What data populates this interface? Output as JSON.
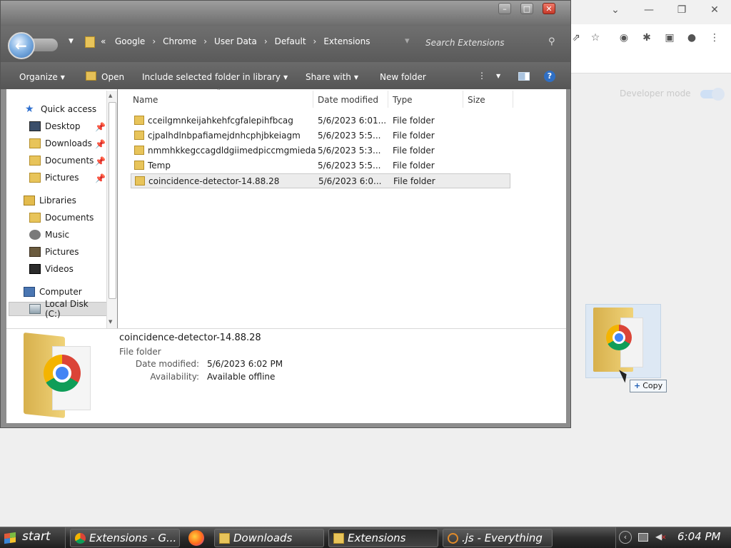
{
  "explorer": {
    "breadcrumb": [
      "Google",
      "Chrome",
      "User Data",
      "Default",
      "Extensions"
    ],
    "search": {
      "placeholder": "Search Extensions"
    },
    "toolbar": {
      "organize": "Organize",
      "open": "Open",
      "include_in_library": "Include selected folder in library",
      "share_with": "Share with",
      "new_folder": "New folder"
    },
    "nav": {
      "quick_access": "Quick access",
      "desktop": "Desktop",
      "downloads": "Downloads",
      "documents": "Documents",
      "pictures": "Pictures",
      "libraries": "Libraries",
      "lib_documents": "Documents",
      "lib_music": "Music",
      "lib_pictures": "Pictures",
      "lib_videos": "Videos",
      "computer": "Computer",
      "local_disk": "Local Disk (C:)"
    },
    "columns": {
      "name": "Name",
      "date": "Date modified",
      "type": "Type",
      "size": "Size"
    },
    "files": [
      {
        "name": "cceilgmnkeijahkehfcgfalepihfbcag",
        "date": "5/6/2023 6:01...",
        "type": "File folder"
      },
      {
        "name": "cjpalhdlnbpafiamejdnhcphjbkeiagm",
        "date": "5/6/2023 5:5...",
        "type": "File folder"
      },
      {
        "name": "nmmhkkegccagdldgiimedpiccmgmieda",
        "date": "5/6/2023 5:3...",
        "type": "File folder"
      },
      {
        "name": "Temp",
        "date": "5/6/2023 5:5...",
        "type": "File folder"
      },
      {
        "name": "coincidence-detector-14.88.28",
        "date": "5/6/2023 6:0...",
        "type": "File folder"
      }
    ],
    "details": {
      "name": "coincidence-detector-14.88.28",
      "type": "File folder",
      "date_label": "Date modified:",
      "date_value": "5/6/2023 6:02 PM",
      "avail_label": "Availability:",
      "avail_value": "Available offline"
    }
  },
  "chrome": {
    "dev_mode_label": "Developer mode"
  },
  "drag": {
    "copy_label": "Copy"
  },
  "taskbar": {
    "start": "start",
    "tasks": [
      {
        "label": "Extensions - G..."
      },
      {
        "label": "Downloads"
      },
      {
        "label": "Extensions"
      },
      {
        "label": ".js - Everything"
      }
    ],
    "clock": "6:04 PM"
  }
}
